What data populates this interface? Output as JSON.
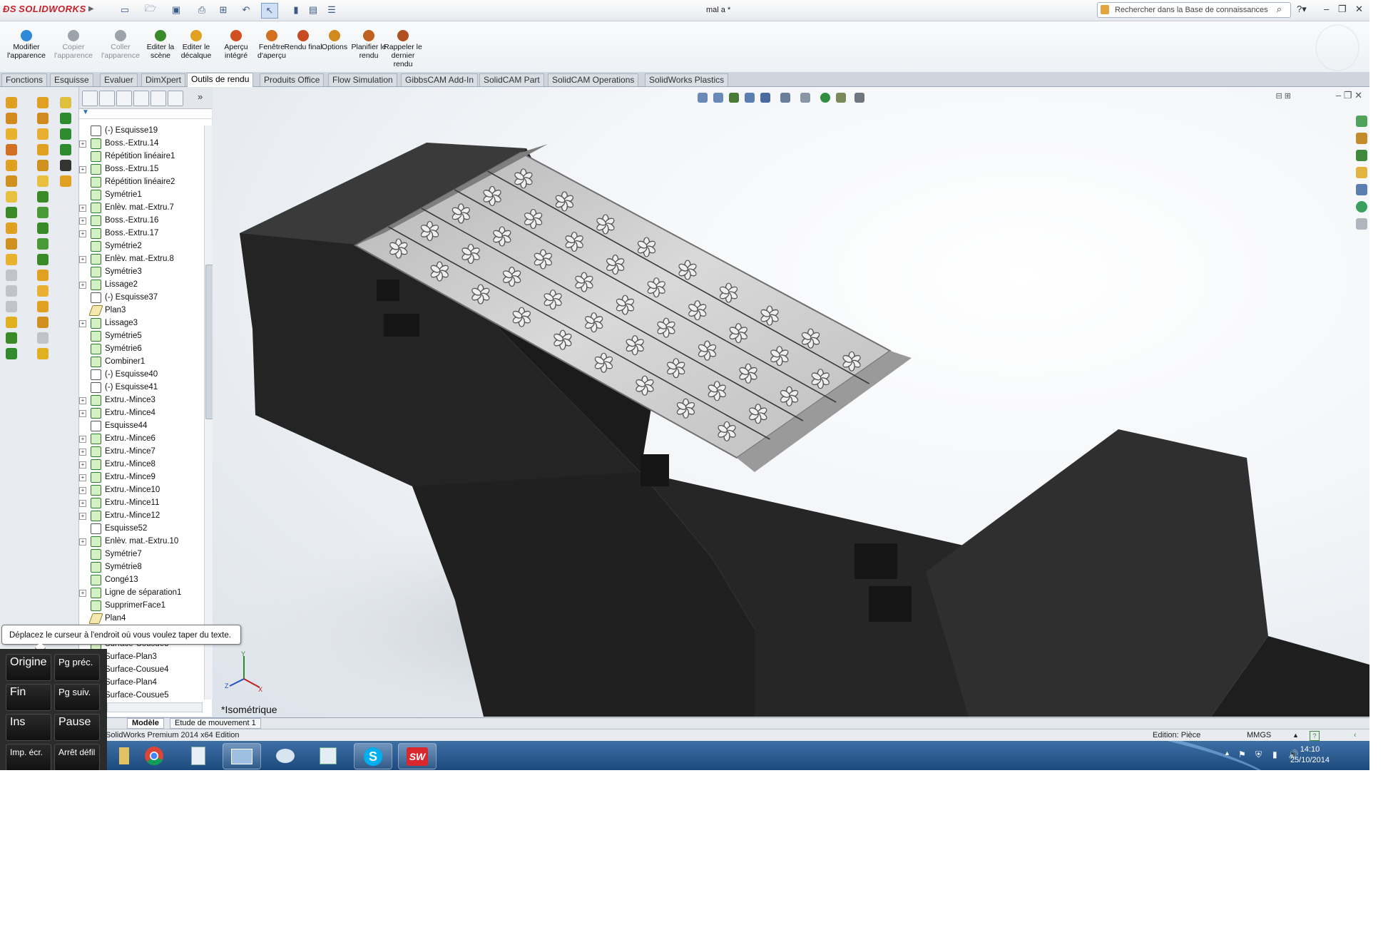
{
  "app": {
    "brand": "SOLIDWORKS",
    "doc_title": "mal a *"
  },
  "search": {
    "placeholder": "Rechercher dans la Base de connaissances"
  },
  "ribbon": [
    {
      "label": "Modifier l'apparence",
      "enabled": true,
      "icon": "appearance-icon",
      "color": "#2c8ad8"
    },
    {
      "label": "Copier l'apparence",
      "enabled": false,
      "icon": "copy-appearance-icon",
      "color": "#9ca3ab"
    },
    {
      "label": "Coller l'apparence",
      "enabled": false,
      "icon": "paste-appearance-icon",
      "color": "#9ca3ab"
    },
    {
      "label": "Editer la scène",
      "enabled": true,
      "icon": "scene-icon",
      "color": "#3a8a2a"
    },
    {
      "label": "Editer le décalque",
      "enabled": true,
      "icon": "decal-icon",
      "color": "#e0a020"
    },
    {
      "label": "Aperçu intégré",
      "enabled": true,
      "icon": "preview-icon",
      "color": "#d05020"
    },
    {
      "label": "Fenêtre d'aperçu",
      "enabled": true,
      "icon": "preview-window-icon",
      "color": "#d07020"
    },
    {
      "label": "Rendu final",
      "enabled": true,
      "icon": "final-render-icon",
      "color": "#c84a20"
    },
    {
      "label": "Options",
      "enabled": true,
      "icon": "options-icon",
      "color": "#d08a20"
    },
    {
      "label": "Planifier le rendu",
      "enabled": true,
      "icon": "schedule-icon",
      "color": "#c06020"
    },
    {
      "label": "Rappeler le dernier rendu",
      "enabled": true,
      "icon": "recall-icon",
      "color": "#b05020"
    }
  ],
  "tabs": [
    {
      "label": "Fonctions"
    },
    {
      "label": "Esquisse"
    },
    {
      "label": "Evaluer"
    },
    {
      "label": "DimXpert"
    },
    {
      "label": "Outils de rendu",
      "active": true
    },
    {
      "label": "Produits Office"
    },
    {
      "label": "Flow Simulation"
    },
    {
      "label": "GibbsCAM Add-In"
    },
    {
      "label": "SolidCAM Part"
    },
    {
      "label": "SolidCAM Operations"
    },
    {
      "label": "SolidWorks Plastics"
    }
  ],
  "tree": [
    {
      "label": "(-) Esquisse19",
      "kind": "sketch",
      "expand": false
    },
    {
      "label": "Boss.-Extru.14",
      "kind": "feature",
      "expand": true
    },
    {
      "label": "Répétition linéaire1",
      "kind": "pattern",
      "expand": false
    },
    {
      "label": "Boss.-Extru.15",
      "kind": "feature",
      "expand": true
    },
    {
      "label": "Répétition linéaire2",
      "kind": "pattern",
      "expand": false
    },
    {
      "label": "Symétrie1",
      "kind": "feature",
      "expand": false
    },
    {
      "label": "Enlèv. mat.-Extru.7",
      "kind": "feature",
      "expand": true
    },
    {
      "label": "Boss.-Extru.16",
      "kind": "feature",
      "expand": true
    },
    {
      "label": "Boss.-Extru.17",
      "kind": "feature",
      "expand": true
    },
    {
      "label": "Symétrie2",
      "kind": "feature",
      "expand": false
    },
    {
      "label": "Enlèv. mat.-Extru.8",
      "kind": "feature",
      "expand": true
    },
    {
      "label": "Symétrie3",
      "kind": "feature",
      "expand": false
    },
    {
      "label": "Lissage2",
      "kind": "loft",
      "expand": true
    },
    {
      "label": "(-) Esquisse37",
      "kind": "sketch",
      "expand": false
    },
    {
      "label": "Plan3",
      "kind": "plane",
      "expand": false
    },
    {
      "label": "Lissage3",
      "kind": "loft",
      "expand": true
    },
    {
      "label": "Symétrie5",
      "kind": "feature",
      "expand": false
    },
    {
      "label": "Symétrie6",
      "kind": "feature",
      "expand": false
    },
    {
      "label": "Combiner1",
      "kind": "feature",
      "expand": false
    },
    {
      "label": "(-) Esquisse40",
      "kind": "sketch",
      "expand": false
    },
    {
      "label": "(-) Esquisse41",
      "kind": "sketch",
      "expand": false
    },
    {
      "label": "Extru.-Mince3",
      "kind": "feature",
      "expand": true
    },
    {
      "label": "Extru.-Mince4",
      "kind": "feature",
      "expand": true
    },
    {
      "label": "Esquisse44",
      "kind": "sketch",
      "expand": false
    },
    {
      "label": "Extru.-Mince6",
      "kind": "feature",
      "expand": true
    },
    {
      "label": "Extru.-Mince7",
      "kind": "feature",
      "expand": true
    },
    {
      "label": "Extru.-Mince8",
      "kind": "feature",
      "expand": true
    },
    {
      "label": "Extru.-Mince9",
      "kind": "feature",
      "expand": true
    },
    {
      "label": "Extru.-Mince10",
      "kind": "feature",
      "expand": true
    },
    {
      "label": "Extru.-Mince11",
      "kind": "feature",
      "expand": true
    },
    {
      "label": "Extru.-Mince12",
      "kind": "feature",
      "expand": true
    },
    {
      "label": "Esquisse52",
      "kind": "sketch",
      "expand": false
    },
    {
      "label": "Enlèv. mat.-Extru.10",
      "kind": "feature",
      "expand": true
    },
    {
      "label": "Symétrie7",
      "kind": "feature",
      "expand": false
    },
    {
      "label": "Symétrie8",
      "kind": "feature",
      "expand": false
    },
    {
      "label": "Congé13",
      "kind": "feature",
      "expand": false
    },
    {
      "label": "Ligne de séparation1",
      "kind": "feature",
      "expand": true
    },
    {
      "label": "SupprimerFace1",
      "kind": "feature",
      "expand": false
    },
    {
      "label": "Plan4",
      "kind": "plane",
      "expand": false
    },
    {
      "label": "Surface-Cousue4",
      "kind": "feature",
      "expand": false
    },
    {
      "label": "Surface-Cousue3",
      "kind": "feature",
      "expand": false
    },
    {
      "label": "Surface-Plan3",
      "kind": "feature",
      "expand": false
    },
    {
      "label": "Surface-Cousue4",
      "kind": "feature",
      "expand": false
    },
    {
      "label": "Surface-Plan4",
      "kind": "feature",
      "expand": false
    },
    {
      "label": "Surface-Cousue5",
      "kind": "feature",
      "expand": false
    }
  ],
  "viewport": {
    "view_label": "*Isométrique",
    "triad": {
      "x": "X",
      "y": "Y",
      "z": "Z"
    }
  },
  "bottom_tabs": [
    {
      "label": "Modèle",
      "active": true
    },
    {
      "label": "Etude de mouvement 1",
      "active": false
    }
  ],
  "status": {
    "left": "SolidWorks Premium 2014 x64 Edition",
    "mode": "Edition: Pièce",
    "units": "MMGS"
  },
  "osk": {
    "tooltip": "Déplacez le curseur à l'endroit où vous voulez taper du texte.",
    "keys": [
      "Origine",
      "Pg préc.",
      "Fin",
      "Pg suiv.",
      "Ins",
      "Pause",
      "Imp. écr.",
      "Arrêt défil"
    ]
  },
  "taskbar": {
    "time": "14:10",
    "date": "25/10/2014"
  },
  "colors": {
    "accent": "#3e6fa5",
    "feature_green": "#2d7a2d",
    "logo_red": "#c8202a"
  }
}
